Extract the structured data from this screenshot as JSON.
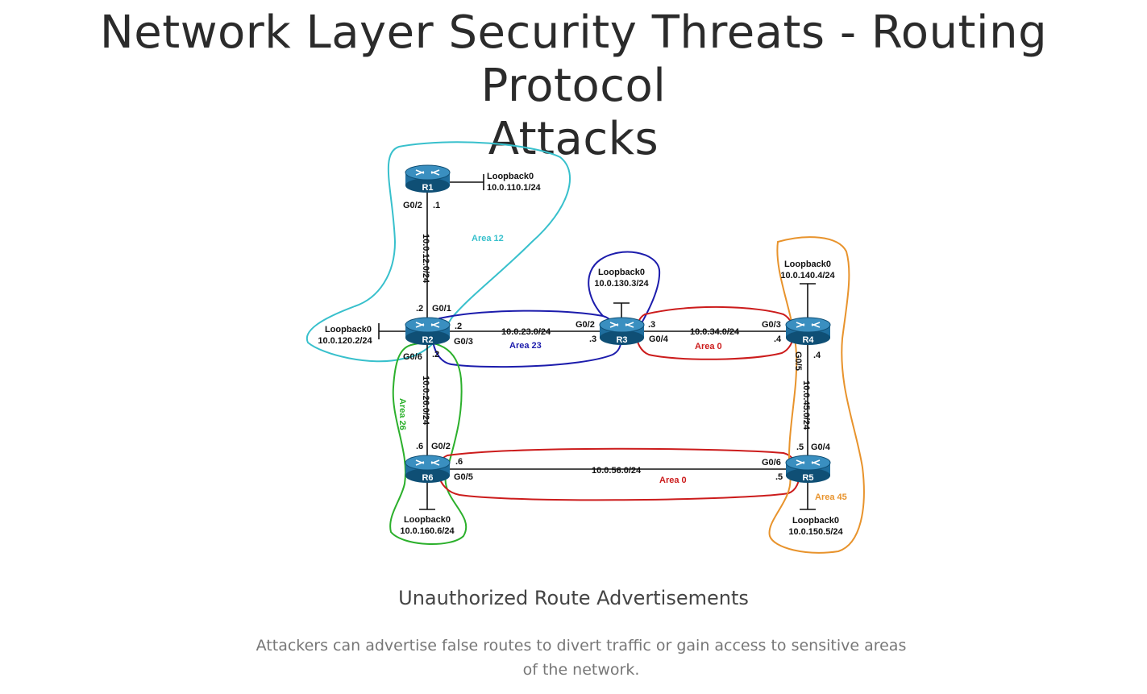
{
  "page": {
    "title_line1": "Network Layer Security Threats - Routing Protocol",
    "title_line2": "Attacks",
    "caption": "Unauthorized Route Advertisements",
    "description": "Attackers can advertise false routes to divert traffic or gain access to sensitive areas of the network."
  },
  "routers": [
    {
      "id": "R1",
      "label": "R1"
    },
    {
      "id": "R2",
      "label": "R2"
    },
    {
      "id": "R3",
      "label": "R3"
    },
    {
      "id": "R4",
      "label": "R4"
    },
    {
      "id": "R5",
      "label": "R5"
    },
    {
      "id": "R6",
      "label": "R6"
    }
  ],
  "loopbacks": {
    "R1": {
      "name": "Loopback0",
      "network": "10.0.110.1/24"
    },
    "R2": {
      "name": "Loopback0",
      "network": "10.0.120.2/24"
    },
    "R3": {
      "name": "Loopback0",
      "network": "10.0.130.3/24"
    },
    "R4": {
      "name": "Loopback0",
      "network": "10.0.140.4/24"
    },
    "R5": {
      "name": "Loopback0",
      "network": "10.0.150.5/24"
    },
    "R6": {
      "name": "Loopback0",
      "network": "10.0.160.6/24"
    }
  },
  "links": {
    "r1_r2": "10.0.12.0/24",
    "r2_r3": "10.0.23.0/24",
    "r3_r4": "10.0.34.0/24",
    "r2_r6": "10.0.26.0/24",
    "r4_r5": "10.0.45.0/24",
    "r6_r5": "10.0.56.0/24"
  },
  "interfaces": {
    "r1_g02": "G0/2",
    "r1_ip": ".1",
    "r2_ip_top": ".2",
    "r2_g01": "G0/1",
    "r2_ip_right": ".2",
    "r2_g03": "G0/3",
    "r2_g06": "G0/6",
    "r2_ip_bottom": ".2",
    "r3_g02": "G0/2",
    "r3_ip_left": ".3",
    "r3_ip_right": ".3",
    "r3_g04": "G0/4",
    "r4_g03": "G0/3",
    "r4_ip_left": ".4",
    "r4_g05": "G0/5",
    "r4_ip_bottom": ".4",
    "r5_ip_top": ".5",
    "r5_g04": "G0/4",
    "r5_g06": "G0/6",
    "r5_ip_left": ".5",
    "r6_ip_top": ".6",
    "r6_g02": "G0/2",
    "r6_ip_right": ".6",
    "r6_g05": "G0/5"
  },
  "areas": {
    "area12": {
      "label": "Area 12",
      "color": "#38c0cc"
    },
    "area23": {
      "label": "Area 23",
      "color": "#1c1cac"
    },
    "area0_top": {
      "label": "Area 0",
      "color": "#cc1c1c"
    },
    "area0_bottom": {
      "label": "Area 0",
      "color": "#cc1c1c"
    },
    "area26": {
      "label": "Area 26",
      "color": "#2cb02c"
    },
    "area45": {
      "label": "Area 45",
      "color": "#e8932c"
    }
  },
  "colors": {
    "router": "#1f6e9e",
    "router_dark": "#0f4f75"
  }
}
